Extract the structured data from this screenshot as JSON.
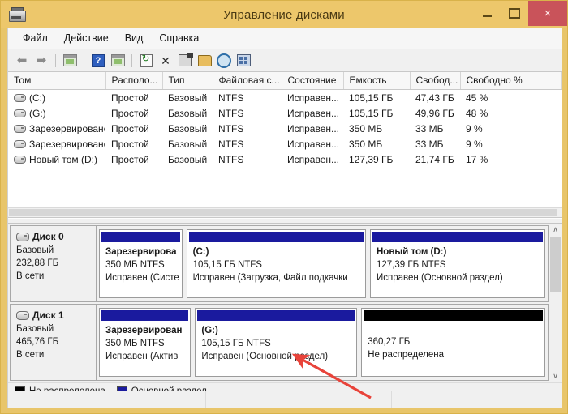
{
  "window": {
    "title": "Управление дисками",
    "icon": "disk-drive-icon",
    "minimize_label": "",
    "maximize_label": "",
    "close_label": "×",
    "titlebar_color": "#edc76b",
    "close_color": "#c9535a"
  },
  "menu": {
    "items": [
      {
        "label": "Файл"
      },
      {
        "label": "Действие"
      },
      {
        "label": "Вид"
      },
      {
        "label": "Справка"
      }
    ]
  },
  "toolbar": {
    "buttons": [
      {
        "name": "back-arrow-icon"
      },
      {
        "name": "forward-arrow-icon"
      },
      {
        "name": "show-hide-console-tree-icon"
      },
      {
        "name": "help-icon",
        "label": "?"
      },
      {
        "name": "show-hide-action-pane-icon"
      },
      {
        "name": "refresh-icon"
      },
      {
        "name": "delete-icon",
        "label": "✕"
      },
      {
        "name": "properties-icon"
      },
      {
        "name": "open-folder-icon"
      },
      {
        "name": "search-icon"
      },
      {
        "name": "rescan-disks-icon"
      }
    ]
  },
  "volume_list": {
    "columns": [
      "Том",
      "Располо...",
      "Тип",
      "Файловая с...",
      "Состояние",
      "Емкость",
      "Свобод...",
      "Свободно %"
    ],
    "rows": [
      {
        "volume": "(C:)",
        "layout": "Простой",
        "type": "Базовый",
        "fs": "NTFS",
        "status": "Исправен...",
        "capacity": "105,15 ГБ",
        "free": "47,43 ГБ",
        "free_pct": "45 %"
      },
      {
        "volume": "(G:)",
        "layout": "Простой",
        "type": "Базовый",
        "fs": "NTFS",
        "status": "Исправен...",
        "capacity": "105,15 ГБ",
        "free": "49,96 ГБ",
        "free_pct": "48 %"
      },
      {
        "volume": "Зарезервировано...",
        "layout": "Простой",
        "type": "Базовый",
        "fs": "NTFS",
        "status": "Исправен...",
        "capacity": "350 МБ",
        "free": "33 МБ",
        "free_pct": "9 %"
      },
      {
        "volume": "Зарезервировано...",
        "layout": "Простой",
        "type": "Базовый",
        "fs": "NTFS",
        "status": "Исправен...",
        "capacity": "350 МБ",
        "free": "33 МБ",
        "free_pct": "9 %"
      },
      {
        "volume": "Новый том (D:)",
        "layout": "Простой",
        "type": "Базовый",
        "fs": "NTFS",
        "status": "Исправен...",
        "capacity": "127,39 ГБ",
        "free": "21,74 ГБ",
        "free_pct": "17 %"
      }
    ]
  },
  "graphical_view": {
    "disks": [
      {
        "name": "Диск 0",
        "type": "Базовый",
        "size": "232,88 ГБ",
        "state": "В сети",
        "partitions": [
          {
            "kind": "primary",
            "name": "Зарезервирова",
            "size_fs": "350 МБ NTFS",
            "status": "Исправен (Систе",
            "width_pct": 19
          },
          {
            "kind": "primary",
            "name": "(C:)",
            "size_fs": "105,15 ГБ NTFS",
            "status": "Исправен (Загрузка, Файл подкачки",
            "width_pct": 41
          },
          {
            "kind": "primary",
            "name": "Новый том  (D:)",
            "size_fs": "127,39 ГБ NTFS",
            "status": "Исправен (Основной раздел)",
            "width_pct": 40
          }
        ]
      },
      {
        "name": "Диск 1",
        "type": "Базовый",
        "size": "465,76 ГБ",
        "state": "В сети",
        "partitions": [
          {
            "kind": "primary",
            "name": "Зарезервирован",
            "size_fs": "350 МБ NTFS",
            "status": "Исправен (Актив",
            "width_pct": 21
          },
          {
            "kind": "primary",
            "name": "(G:)",
            "size_fs": "105,15 ГБ NTFS",
            "status": "Исправен (Основной раздел)",
            "width_pct": 37
          },
          {
            "kind": "unalloc",
            "name": "",
            "size_fs": "360,27 ГБ",
            "status": "Не распределена",
            "width_pct": 42
          }
        ]
      }
    ],
    "scrollbar": {
      "up_arrow": "∧",
      "down_arrow": "∨"
    }
  },
  "legend": {
    "entries": [
      {
        "label": "Не распределена",
        "color": "#000000"
      },
      {
        "label": "Основной раздел",
        "color": "#1a1a9e"
      }
    ]
  },
  "statusbar": {
    "segments": [
      "",
      "",
      ""
    ]
  },
  "annotation": {
    "arrow_color": "#e8433a",
    "description": "red-arrow-pointing-to-g-partition"
  }
}
